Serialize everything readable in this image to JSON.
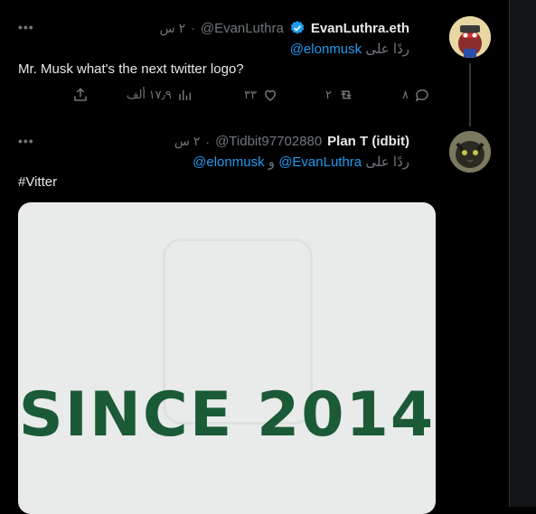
{
  "tweet1": {
    "name": "EvanLuthra.eth",
    "handle": "@EvanLuthra",
    "time": "٢ س",
    "reply_prefix": "ردًا على",
    "reply_user": "@elonmusk",
    "text": "Mr. Musk what's the next twitter logo?",
    "actions": {
      "replies": "٨",
      "retweets": "٢",
      "likes": "٣٣",
      "views": "١٧٫٩ ألف"
    }
  },
  "tweet2": {
    "name": "Plan T (idbit)",
    "handle": "@Tidbit97702880",
    "time": "٢ س",
    "reply_prefix": "ردًا على",
    "reply_user1": "@EvanLuthra",
    "reply_conj": "و",
    "reply_user2": "@elonmusk",
    "hashtag": "#Vitter",
    "image_text": "SINCE 2014"
  },
  "colors": {
    "link": "#1d9bf0",
    "muted": "#71767b",
    "verified": "#1d9bf0",
    "image_text": "#1b5a37"
  },
  "icons": [
    "more-icon",
    "verified-badge-icon",
    "reply-icon",
    "retweet-icon",
    "like-icon",
    "views-icon",
    "share-icon"
  ]
}
